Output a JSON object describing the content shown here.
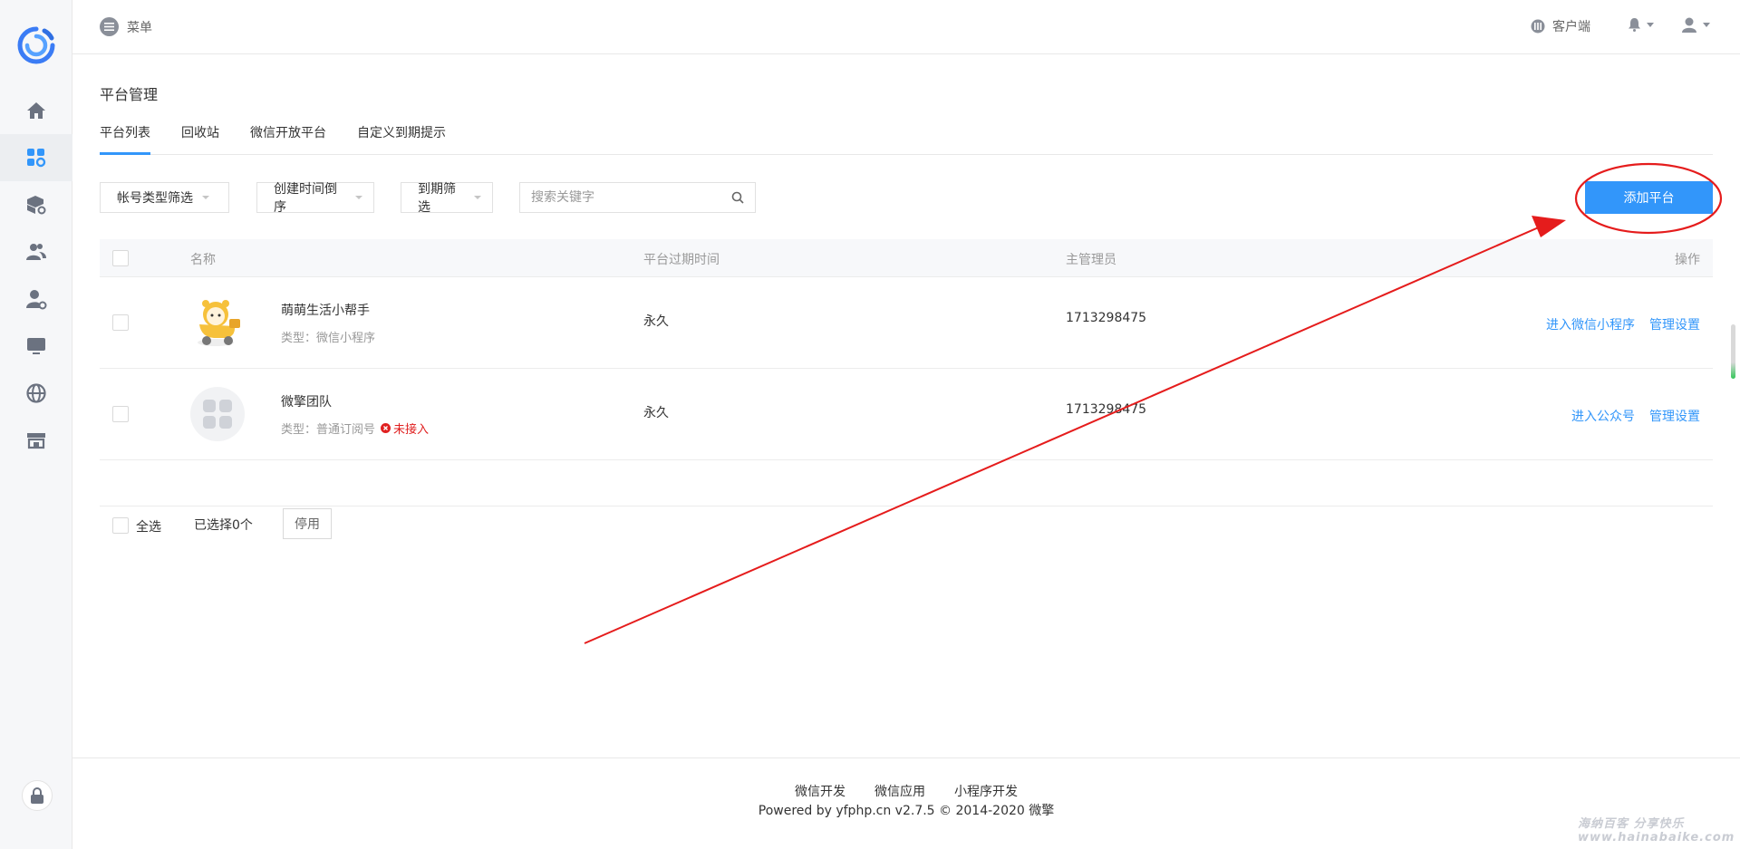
{
  "header": {
    "menu_label": "菜单",
    "client_label": "客户端"
  },
  "page": {
    "title": "平台管理"
  },
  "tabs": [
    {
      "label": "平台列表"
    },
    {
      "label": "回收站"
    },
    {
      "label": "微信开放平台"
    },
    {
      "label": "自定义到期提示"
    }
  ],
  "filters": {
    "account_type": "帐号类型筛选",
    "sort": "创建时间倒序",
    "expiry": "到期筛选",
    "search_placeholder": "搜索关键字",
    "add_button": "添加平台"
  },
  "table": {
    "columns": {
      "name": "名称",
      "expire": "平台过期时间",
      "admin": "主管理员",
      "actions": "操作"
    },
    "rows": [
      {
        "name": "萌萌生活小帮手",
        "type": "类型：微信小程序",
        "status": "",
        "expire": "永久",
        "admin": "1713298475",
        "action_enter": "进入微信小程序",
        "action_manage": "管理设置"
      },
      {
        "name": "微擎团队",
        "type": "类型：普通订阅号",
        "status": "未接入",
        "expire": "永久",
        "admin": "1713298475",
        "action_enter": "进入公众号",
        "action_manage": "管理设置"
      }
    ]
  },
  "bulk": {
    "select_all": "全选",
    "selected_count": "已选择0个",
    "disable_button": "停用"
  },
  "footer": {
    "links": [
      "微信开发",
      "微信应用",
      "小程序开发"
    ],
    "copyright": "Powered by yfphp.cn v2.7.5 © 2014-2020 微擎"
  },
  "watermark": "海纳百客 分享快乐 www.hainabaike.com",
  "colors": {
    "accent": "#3296fa",
    "danger": "#e02020",
    "annotation": "#e51c1c"
  },
  "icons": {
    "logo": "brand-logo",
    "sidebar": [
      "home-icon",
      "apps-settings-icon",
      "box-settings-icon",
      "users-icon",
      "user-settings-icon",
      "monitor-icon",
      "globe-icon",
      "store-icon",
      "lock-icon"
    ]
  }
}
